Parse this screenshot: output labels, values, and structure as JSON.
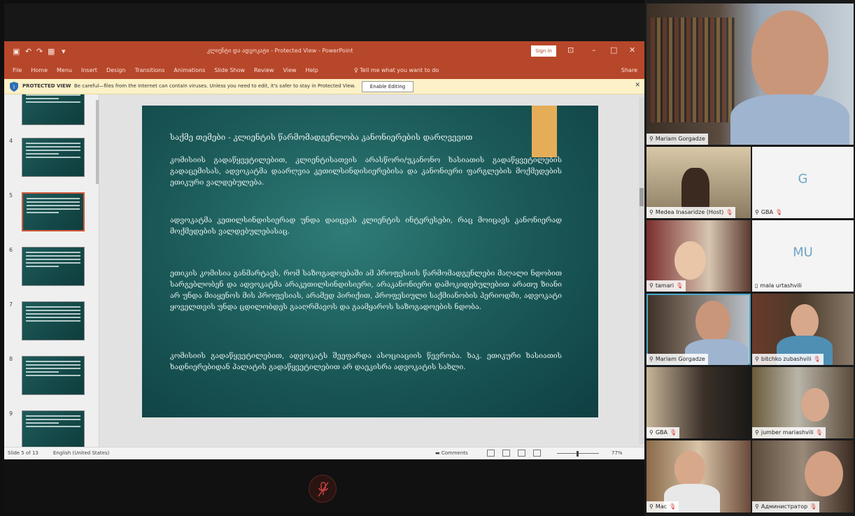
{
  "ppt": {
    "title": "კლიენტი და ადვოკატი - Protected View - PowerPoint",
    "sign_in": "Sign in",
    "ribbon_tabs": [
      "File",
      "Home",
      "Menu",
      "Insert",
      "Design",
      "Transitions",
      "Animations",
      "Slide Show",
      "Review",
      "View",
      "Help"
    ],
    "tell_me": "Tell me what you want to do",
    "share": "Share",
    "protected_label": "PROTECTED VIEW",
    "protected_msg": "Be careful—files from the Internet can contain viruses. Unless you need to edit, it's safer to stay in Protected View.",
    "enable_editing": "Enable Editing",
    "thumb_numbers": [
      "4",
      "5",
      "6",
      "7",
      "8",
      "9"
    ],
    "status_slide": "Slide 5 of 13",
    "status_lang": "English (United States)",
    "status_comments": "Comments",
    "status_zoom": "77%"
  },
  "slide": {
    "title": "საქმე თემები - კლიენტის წარმომადგენლობა კანონიერების დარღვევით",
    "p1": "კომისიის გადაწყვეტილებით, კლიენტისათვის არასწორი/უკანონო ხასიათის გადაწყვეტილების გადაცემისას, ადვოკატმა დაარღვია კეთილსინდისიერებისა და კანონიერი ფარგლების მოქმედების ეთიკური ვალდებულება.",
    "p2": "ადვოკატმა კეთილსინდისიერად უნდა დაიცვას კლიენტის ინტერესები, რაც მოიცავს კანონიერად მოქმედების ვალდებულებასაც.",
    "p3": "ეთიკის კომისია განმარტავს, რომ საზოგადოებაში ამ პროფესიის წარმომადგენლები მაღალი ნდობით სარგებლობენ და ადვოკატმა არაკეთილსინდისიერი, არაკანონიერი დამოკიდებულებით არათუ ზიანი არ უნდა მიაყენოს მის პროფესიას, არამედ პირიქით, პროფესიული საქმიანობის პერიოდში, ადვოკატი ყოველთვის უნდა ცდილობდეს გააღრმავოს და გაამყაროს საზოგადოების ნდობა.",
    "p4": "კომისიის გადაწყვეტილებით, ადვოკატს შეეფარდა ასოციაციის წევრობა. ხაკ. ეთიკური ხასიათის ხადნიერებიდან პალატის გადაწყვეტილებით არ დაეკისრა ადვოკატის სახლი."
  },
  "participants": [
    {
      "name": "Mariam Gorgadze",
      "muted": false
    },
    {
      "name": "Medea Inasaridze (Host)",
      "muted": true
    },
    {
      "name": "GBA",
      "initials": "G",
      "muted": true
    },
    {
      "name": "tamari",
      "muted": true
    },
    {
      "name": "mala urtashvili",
      "initials": "MU",
      "muted": false
    },
    {
      "name": "Mariam Gorgadze",
      "muted": false
    },
    {
      "name": "bitchko zubashvili",
      "muted": true
    },
    {
      "name": "GBA",
      "muted": true
    },
    {
      "name": "jumber mariashvili",
      "muted": true
    },
    {
      "name": "Mac",
      "muted": true
    },
    {
      "name": "Администратор",
      "muted": true
    }
  ],
  "colors": {
    "ppt_accent": "#b7472a",
    "slide_bg": "#1b5a59",
    "slide_accent": "#e6ad59",
    "speaker_outline": "#4aa8c9",
    "mute_red": "#d8342c"
  }
}
